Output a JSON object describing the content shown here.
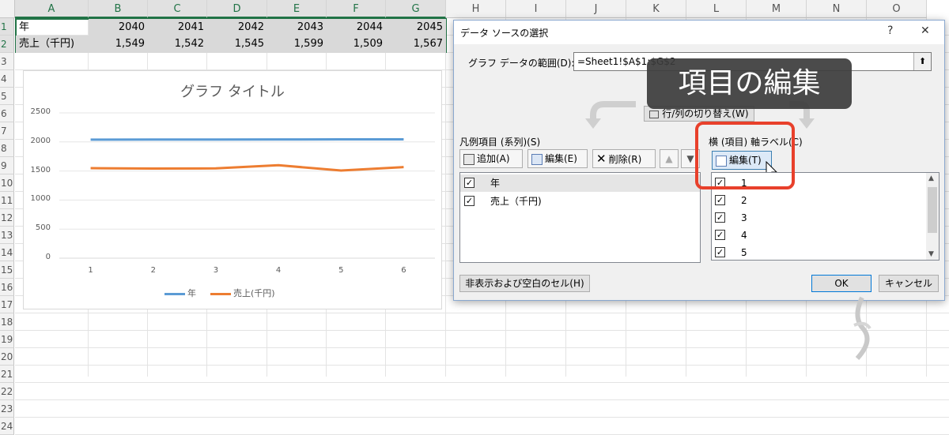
{
  "sheet": {
    "columns": [
      "A",
      "B",
      "C",
      "D",
      "E",
      "F",
      "G",
      "H",
      "I",
      "J",
      "K",
      "L",
      "M",
      "N",
      "O"
    ],
    "rows": [
      "1",
      "2",
      "3",
      "4",
      "5",
      "6",
      "7",
      "8",
      "9",
      "10",
      "11",
      "12",
      "13",
      "14",
      "15",
      "16",
      "17",
      "18",
      "19",
      "20",
      "21",
      "22",
      "23",
      "24"
    ],
    "row1": {
      "label": "年",
      "values": [
        "2040",
        "2041",
        "2042",
        "2043",
        "2044",
        "2045"
      ]
    },
    "row2": {
      "label": "売上（千円)",
      "values": [
        "1,549",
        "1,542",
        "1,545",
        "1,599",
        "1,509",
        "1,567"
      ]
    }
  },
  "chart_data": {
    "type": "line",
    "title": "グラフ タイトル",
    "categories": [
      "1",
      "2",
      "3",
      "4",
      "5",
      "6"
    ],
    "ylim": [
      0,
      2500
    ],
    "yticks": [
      "0",
      "500",
      "1000",
      "1500",
      "2000",
      "2500"
    ],
    "series": [
      {
        "name": "年",
        "values": [
          2040,
          2041,
          2042,
          2043,
          2044,
          2045
        ],
        "color": "#5b9bd5"
      },
      {
        "name": "売上(千円)",
        "values": [
          1549,
          1542,
          1545,
          1599,
          1509,
          1567
        ],
        "color": "#ed7d31"
      }
    ],
    "legend": "bottom",
    "grid": true
  },
  "dialog": {
    "title": "データ ソースの選択",
    "help": "?",
    "close": "✕",
    "range_label": "グラフ データの範囲(D):",
    "range_value": "=Sheet1!$A$1:$G$2",
    "switch_label": "行/列の切り替え(W)",
    "legend_label": "凡例項目 (系列)(S)",
    "axis_label": "横 (項目) 軸ラベル(C)",
    "add": "追加(A)",
    "edit": "編集(E)",
    "delete": "削除(R)",
    "axis_edit": "編集(T)",
    "series_items": [
      "年",
      "売上（千円)"
    ],
    "axis_items": [
      "1",
      "2",
      "3",
      "4",
      "5"
    ],
    "hidden_cells": "非表示および空白のセル(H)",
    "ok": "OK",
    "cancel": "キャンセル"
  },
  "overlay": {
    "text": "項目の編集"
  },
  "colors": {
    "accent": "#217346",
    "highlight": "#e8402b"
  }
}
